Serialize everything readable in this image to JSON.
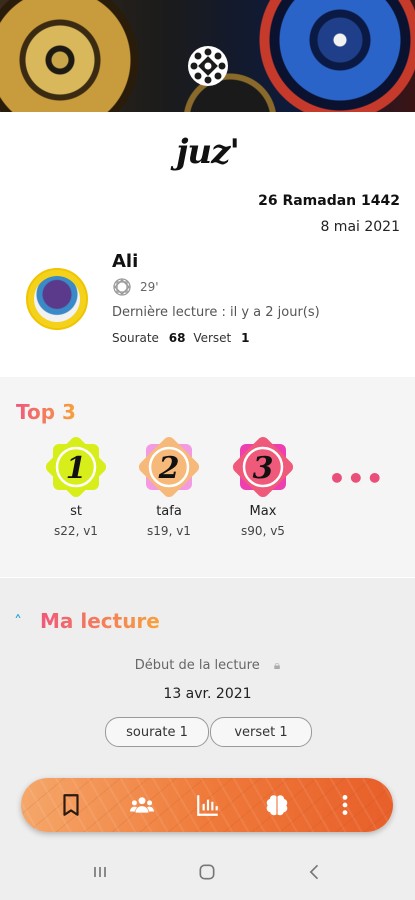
{
  "app": {
    "title": "juz'"
  },
  "date": {
    "hijri": "26 Ramadan 1442",
    "gregorian": "8 mai 2021"
  },
  "user": {
    "name": "Ali",
    "juz_count": "29'",
    "last_reading": "Dernière lecture : il y a 2 jour(s)",
    "sourate_label": "Sourate",
    "sourate_value": "68",
    "verset_label": "Verset",
    "verset_value": "1"
  },
  "top3": {
    "title": "Top 3",
    "more_label": "•••",
    "ranks": [
      {
        "rank": "1",
        "name": "st",
        "position": "s22, v1",
        "color": "#d7ee1a"
      },
      {
        "rank": "2",
        "name": "tafa",
        "position": "s19, v1",
        "color": "#f39be0"
      },
      {
        "rank": "3",
        "name": "Max",
        "position": "s90, v5",
        "color": "#ee3fb0"
      }
    ]
  },
  "ma_lecture": {
    "title": "Ma lecture",
    "start_label": "Début de la lecture",
    "start_date": "13 avr. 2021",
    "sourate_button": "sourate 1",
    "verset_button": "verset 1"
  },
  "nav": {
    "icons": [
      "bookmark-icon",
      "group-icon",
      "stats-icon",
      "brain-icon",
      "more-vert-icon"
    ]
  },
  "colors": {
    "accent_start": "#f0587a",
    "accent_end": "#f7a23b",
    "chevron": "#1aa3d9",
    "navbar": "#ef7a3a"
  }
}
